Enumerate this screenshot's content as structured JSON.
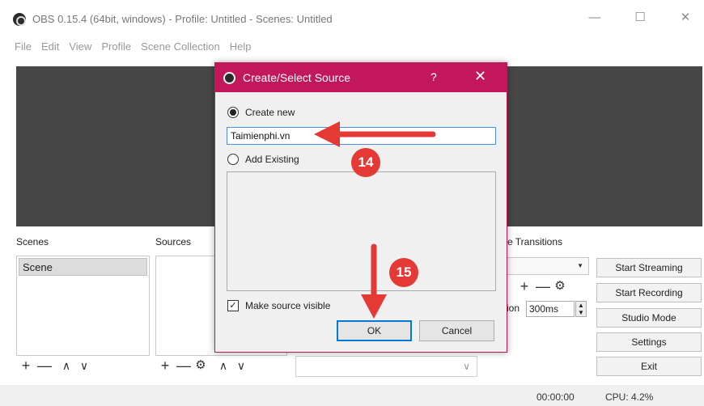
{
  "window": {
    "title": "OBS 0.15.4 (64bit, windows) - Profile: Untitled - Scenes: Untitled",
    "controls": {
      "minimize": "—",
      "maximize": "☐",
      "close": "✕"
    }
  },
  "menu": [
    "File",
    "Edit",
    "View",
    "Profile",
    "Scene Collection",
    "Help"
  ],
  "docks": {
    "scenes_label": "Scenes",
    "sources_label": "Sources",
    "transitions_label": "e Transitions",
    "scenes": [
      "Scene"
    ],
    "duration_label": "ion",
    "duration_value": "300ms"
  },
  "toolbar_glyphs": {
    "add": "+",
    "remove": "—",
    "up": "∧",
    "down": "∨",
    "gear": "⚙"
  },
  "buttons": {
    "start_streaming": "Start Streaming",
    "start_recording": "Start Recording",
    "studio_mode": "Studio Mode",
    "settings": "Settings",
    "exit": "Exit"
  },
  "status": {
    "time": "00:00:00",
    "cpu": "CPU: 4.2%"
  },
  "dialog": {
    "title": "Create/Select Source",
    "help": "?",
    "close": "✕",
    "create_new_label": "Create new",
    "name_value": "Taimienphi.vn",
    "add_existing_label": "Add Existing",
    "make_visible_label": "Make source visible",
    "ok_label": "OK",
    "cancel_label": "Cancel",
    "create_new_checked": true,
    "make_visible_checked": true
  },
  "annotations": {
    "step1": "14",
    "step2": "15",
    "color": "#e53935"
  },
  "colors": {
    "dialog_accent": "#c2185b",
    "preview_bg": "#474747"
  }
}
